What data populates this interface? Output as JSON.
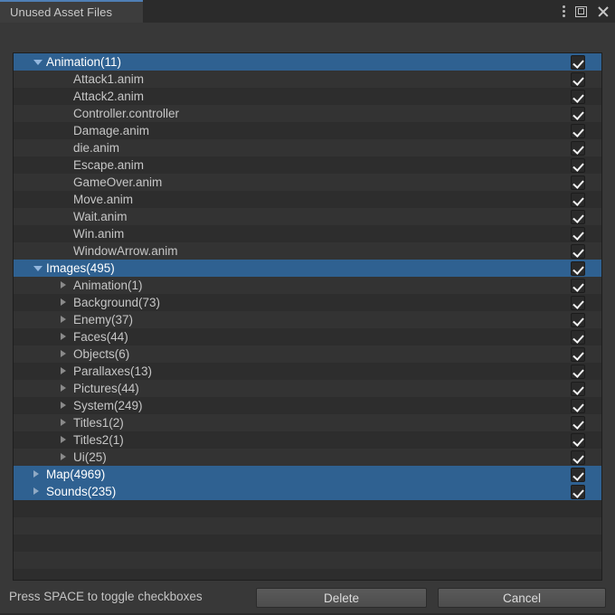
{
  "window": {
    "tab_label": "Unused Asset Files",
    "controls": [
      {
        "name": "kebab-menu-icon",
        "label": "⋮"
      },
      {
        "name": "maximize-icon",
        "label": "□"
      },
      {
        "name": "close-icon",
        "label": "✕"
      }
    ]
  },
  "colors": {
    "selection": "#2f6191",
    "tab_accent": "#4f7fb5",
    "background": "#383838",
    "row_odd": "#2d2d2d",
    "row_even": "#333333"
  },
  "tree": {
    "rows": [
      {
        "label": "Animation(11)",
        "depth": 0,
        "arrow": "down",
        "selected": true,
        "checked": true
      },
      {
        "label": "Attack1.anim",
        "depth": 2,
        "arrow": "none",
        "selected": false,
        "checked": true
      },
      {
        "label": "Attack2.anim",
        "depth": 2,
        "arrow": "none",
        "selected": false,
        "checked": true
      },
      {
        "label": "Controller.controller",
        "depth": 2,
        "arrow": "none",
        "selected": false,
        "checked": true
      },
      {
        "label": "Damage.anim",
        "depth": 2,
        "arrow": "none",
        "selected": false,
        "checked": true
      },
      {
        "label": "die.anim",
        "depth": 2,
        "arrow": "none",
        "selected": false,
        "checked": true
      },
      {
        "label": "Escape.anim",
        "depth": 2,
        "arrow": "none",
        "selected": false,
        "checked": true
      },
      {
        "label": "GameOver.anim",
        "depth": 2,
        "arrow": "none",
        "selected": false,
        "checked": true
      },
      {
        "label": "Move.anim",
        "depth": 2,
        "arrow": "none",
        "selected": false,
        "checked": true
      },
      {
        "label": "Wait.anim",
        "depth": 2,
        "arrow": "none",
        "selected": false,
        "checked": true
      },
      {
        "label": "Win.anim",
        "depth": 2,
        "arrow": "none",
        "selected": false,
        "checked": true
      },
      {
        "label": "WindowArrow.anim",
        "depth": 2,
        "arrow": "none",
        "selected": false,
        "checked": true
      },
      {
        "label": "Images(495)",
        "depth": 0,
        "arrow": "down",
        "selected": true,
        "checked": true
      },
      {
        "label": "Animation(1)",
        "depth": 1,
        "arrow": "right",
        "selected": false,
        "checked": true
      },
      {
        "label": "Background(73)",
        "depth": 1,
        "arrow": "right",
        "selected": false,
        "checked": true
      },
      {
        "label": "Enemy(37)",
        "depth": 1,
        "arrow": "right",
        "selected": false,
        "checked": true
      },
      {
        "label": "Faces(44)",
        "depth": 1,
        "arrow": "right",
        "selected": false,
        "checked": true
      },
      {
        "label": "Objects(6)",
        "depth": 1,
        "arrow": "right",
        "selected": false,
        "checked": true
      },
      {
        "label": "Parallaxes(13)",
        "depth": 1,
        "arrow": "right",
        "selected": false,
        "checked": true
      },
      {
        "label": "Pictures(44)",
        "depth": 1,
        "arrow": "right",
        "selected": false,
        "checked": true
      },
      {
        "label": "System(249)",
        "depth": 1,
        "arrow": "right",
        "selected": false,
        "checked": true
      },
      {
        "label": "Titles1(2)",
        "depth": 1,
        "arrow": "right",
        "selected": false,
        "checked": true
      },
      {
        "label": "Titles2(1)",
        "depth": 1,
        "arrow": "right",
        "selected": false,
        "checked": true
      },
      {
        "label": "Ui(25)",
        "depth": 1,
        "arrow": "right",
        "selected": false,
        "checked": true
      },
      {
        "label": "Map(4969)",
        "depth": 0,
        "arrow": "right",
        "selected": true,
        "checked": true
      },
      {
        "label": "Sounds(235)",
        "depth": 0,
        "arrow": "right",
        "selected": true,
        "checked": true
      }
    ],
    "empty_row_count": 4
  },
  "footer": {
    "hint": "Press SPACE to toggle checkboxes",
    "delete_label": "Delete",
    "cancel_label": "Cancel"
  }
}
